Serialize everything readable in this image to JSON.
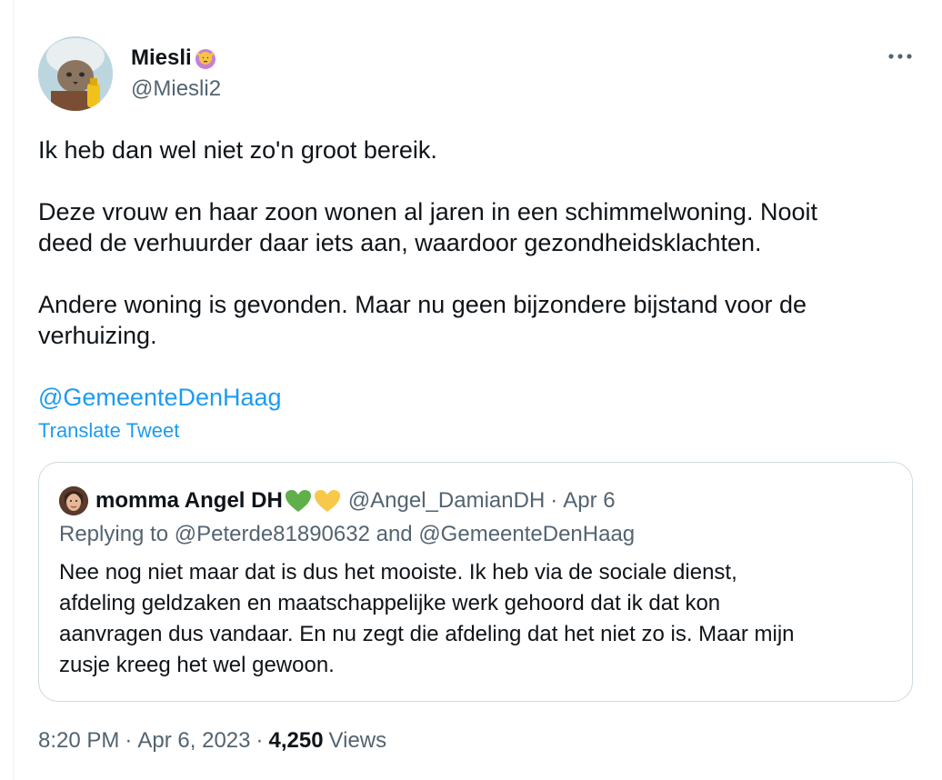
{
  "author": {
    "display_name": "Miesli",
    "handle": "@Miesli2"
  },
  "tweet": {
    "line1": "Ik heb dan wel niet zo'n groot bereik.",
    "line2a": "Deze vrouw en haar zoon wonen al jaren in een schimmelwoning. Nooit",
    "line2b": "deed de verhuurder daar iets aan, waardoor gezondheidsklachten.",
    "line3a": "Andere woning is gevonden. Maar nu geen bijzondere bijstand voor de",
    "line3b": "verhuizing.",
    "mention": "@GemeenteDenHaag",
    "translate_label": "Translate Tweet"
  },
  "quote": {
    "display_name": "momma Angel DH",
    "handle": "@Angel_DamianDH",
    "date": "Apr 6",
    "replying_to": "Replying to @Peterde81890632 and @GemeenteDenHaag",
    "body_lines": [
      "Nee nog niet maar dat is dus het mooiste. Ik heb via de sociale dienst,",
      "afdeling geldzaken en maatschappelijke werk gehoord dat ik dat kon",
      "aanvragen dus vandaar. En nu zegt die afdeling dat het niet zo is. Maar mijn",
      "zusje kreeg het wel gewoon."
    ]
  },
  "meta": {
    "time": "8:20 PM",
    "date": "Apr 6, 2023",
    "views_count": "4,250",
    "views_label": "Views",
    "separator": "·"
  },
  "icons": {
    "more": "more-horizontal-icon",
    "author_emoji": "person-gesturing-no-emoji",
    "quote_emojis": [
      "green-heart-emoji",
      "yellow-heart-emoji"
    ]
  },
  "colors": {
    "link": "#1d9bf0",
    "secondary_text": "#536471",
    "primary_text": "#0f1419",
    "border": "#cfd9de",
    "green_heart": "#5fb04a",
    "yellow_heart": "#f7c84a"
  }
}
